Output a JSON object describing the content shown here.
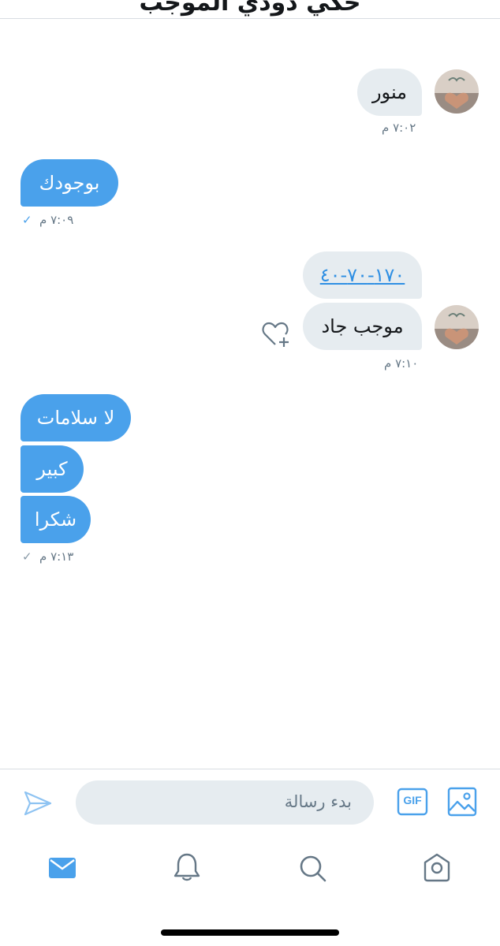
{
  "header": {
    "title": "حكي دودي الموجب"
  },
  "messages": [
    {
      "direction": "in",
      "text": "منور",
      "time": "٧:٠٢ م"
    },
    {
      "direction": "out",
      "text": "بوجودك",
      "time": "٧:٠٩ م"
    },
    {
      "direction": "in",
      "text": "١٧٠-٧٠-٤٠"
    },
    {
      "direction": "in",
      "text": "موجب جاد",
      "time": "٧:١٠ م"
    },
    {
      "direction": "out",
      "text": "لا سلامات"
    },
    {
      "direction": "out",
      "text": "كبير"
    },
    {
      "direction": "out",
      "text": "شكرا",
      "time": "٧:١٣ م"
    }
  ],
  "composer": {
    "placeholder": "بدء رسالة",
    "gif_label": "GIF"
  },
  "tabbar": {
    "items": [
      "messages-icon",
      "notifications-icon",
      "search-icon",
      "home-icon"
    ],
    "active": "messages-icon"
  },
  "colors": {
    "accent": "#4aa1eb",
    "incoming_bubble": "#e6ecf0",
    "muted_text": "#657786"
  }
}
